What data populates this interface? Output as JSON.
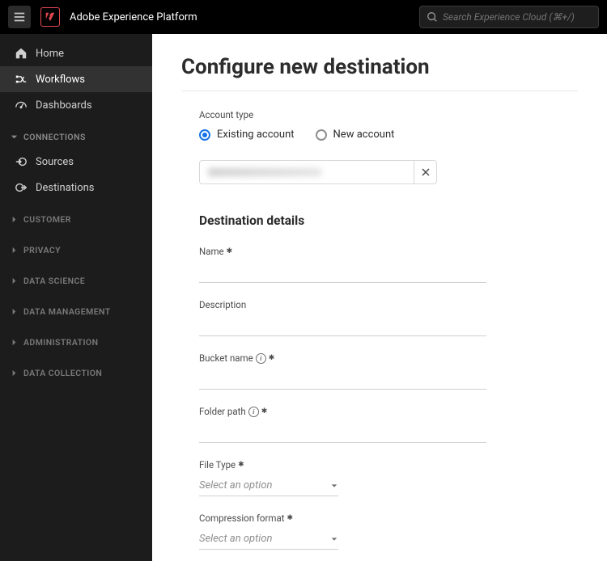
{
  "header": {
    "app_title": "Adobe Experience Platform",
    "search_placeholder": "Search Experience Cloud (⌘+/)"
  },
  "sidebar": {
    "top_items": [
      {
        "label": "Home",
        "icon": "home"
      },
      {
        "label": "Workflows",
        "icon": "workflow",
        "active": true
      },
      {
        "label": "Dashboards",
        "icon": "dashboard"
      }
    ],
    "groups": [
      {
        "label": "CONNECTIONS",
        "expanded": true,
        "items": [
          {
            "label": "Sources",
            "icon": "sources"
          },
          {
            "label": "Destinations",
            "icon": "destinations"
          }
        ]
      },
      {
        "label": "CUSTOMER",
        "expanded": false
      },
      {
        "label": "PRIVACY",
        "expanded": false
      },
      {
        "label": "DATA SCIENCE",
        "expanded": false
      },
      {
        "label": "DATA MANAGEMENT",
        "expanded": false
      },
      {
        "label": "ADMINISTRATION",
        "expanded": false
      },
      {
        "label": "DATA COLLECTION",
        "expanded": false
      }
    ]
  },
  "main": {
    "title": "Configure new destination",
    "account_type_label": "Account type",
    "account_options": {
      "existing": "Existing account",
      "new_acc": "New account"
    },
    "destination_details_title": "Destination details",
    "fields": {
      "name_label": "Name",
      "description_label": "Description",
      "bucket_label": "Bucket name",
      "folder_label": "Folder path",
      "file_type_label": "File Type",
      "file_type_placeholder": "Select an option",
      "compression_label": "Compression format",
      "compression_placeholder": "Select an option"
    }
  }
}
